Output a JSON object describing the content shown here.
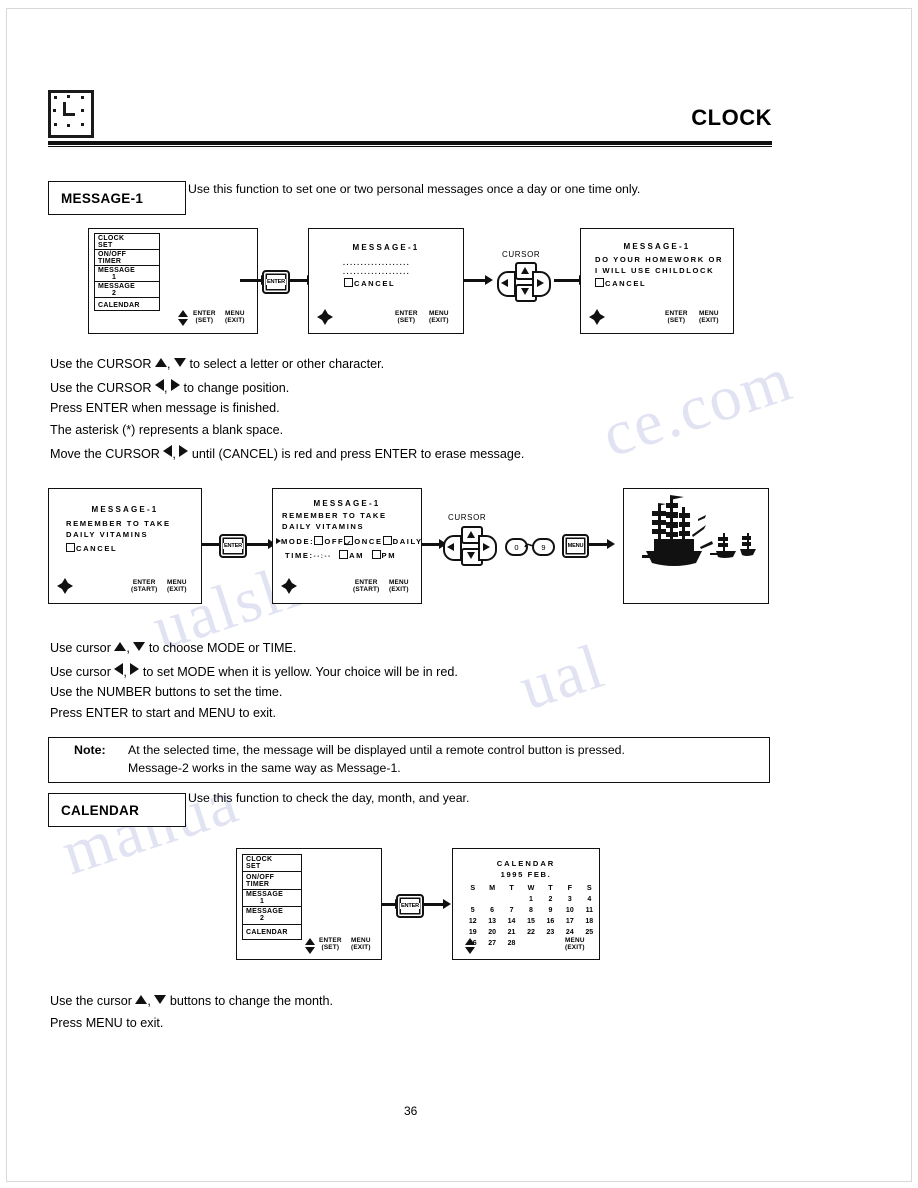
{
  "page": {
    "number": "36",
    "header_title": "CLOCK",
    "header_icon": "clock-icon"
  },
  "sections": [
    {
      "label": "MESSAGE-1",
      "intro": "Use this function to set one or two personal messages once a day or one time only."
    },
    {
      "label": "CALENDAR",
      "intro": "Use this function to check the day, month, and year."
    }
  ],
  "menu_screen": {
    "items": [
      {
        "line1": "CLOCK",
        "line2": "SET"
      },
      {
        "line1": "ON/OFF",
        "line2": "TIMER"
      },
      {
        "line1": "MESSAGE",
        "line2": "1"
      },
      {
        "line1": "MESSAGE",
        "line2": "2"
      },
      {
        "line1": "CALENDAR",
        "line2": ""
      }
    ],
    "footer_enter": "ENTER",
    "footer_enter_sub": "(SET)",
    "footer_menu": "MENU",
    "footer_menu_sub": "(EXIT)"
  },
  "osd_blank_message": {
    "title": "MESSAGE-1",
    "dots_line1": "...................",
    "dots_line2": "...................",
    "cancel": "CANCEL",
    "footer_enter": "ENTER",
    "footer_enter_sub": "(SET)",
    "footer_menu": "MENU",
    "footer_menu_sub": "(EXIT)"
  },
  "osd_childlock_message": {
    "title": "MESSAGE-1",
    "line1": "DO YOUR HOMEWORK OR",
    "line2": "I WILL USE CHILDLOCK",
    "cancel": "CANCEL",
    "footer_enter": "ENTER",
    "footer_enter_sub": "(SET)",
    "footer_menu": "MENU",
    "footer_menu_sub": "(EXIT)"
  },
  "osd_vitamins_message": {
    "title": "MESSAGE-1",
    "line1": "REMEMBER  TO  TAKE",
    "line2": "DAILY  VITAMINS",
    "cancel": "CANCEL",
    "footer_enter": "ENTER",
    "footer_enter_sub": "(START)",
    "footer_menu": "MENU",
    "footer_menu_sub": "(EXIT)"
  },
  "osd_mode_time": {
    "title": "MESSAGE-1",
    "line1": "REMEMBER  TO  TAKE",
    "line2": "DAILY  VITAMINS",
    "mode_label": "MODE:",
    "mode_options": [
      {
        "label": "OFF",
        "checked": false
      },
      {
        "label": "ONCE",
        "checked": true
      },
      {
        "label": "DAILY",
        "checked": false
      }
    ],
    "time_label": "TIME:",
    "time_value": "--:--",
    "time_options": [
      {
        "label": "AM",
        "checked": false
      },
      {
        "label": "PM",
        "checked": false
      }
    ],
    "footer_enter": "ENTER",
    "footer_enter_sub": "(START)",
    "footer_menu": "MENU",
    "footer_menu_sub": "(EXIT)"
  },
  "calendar_screen": {
    "title": "CALENDAR",
    "subtitle": "1995   FEB.",
    "weekdays": [
      "S",
      "M",
      "T",
      "W",
      "T",
      "F",
      "S"
    ],
    "weeks": [
      [
        "",
        "",
        "",
        "1",
        "2",
        "3",
        "4"
      ],
      [
        "5",
        "6",
        "7",
        "8",
        "9",
        "10",
        "11"
      ],
      [
        "12",
        "13",
        "14",
        "15",
        "16",
        "17",
        "18"
      ],
      [
        "19",
        "20",
        "21",
        "22",
        "23",
        "24",
        "25"
      ],
      [
        "26",
        "27",
        "28",
        "",
        "",
        "",
        ""
      ]
    ],
    "footer_menu": "MENU",
    "footer_menu_sub": "(EXIT)"
  },
  "buttons": {
    "enter_label": "ENTER",
    "menu_label": "MENU",
    "cursor_caption": "CURSOR",
    "number_low": "0",
    "number_high": "9"
  },
  "instructions_message": {
    "l1a": "Use the CURSOR",
    "l1b": ",",
    "l1c": "to select a letter or other character.",
    "l2a": "Use the CURSOR",
    "l2b": ",",
    "l2c": "to change position.",
    "l3": "Press ENTER when message is finished.",
    "l4": "The asterisk (*) represents a blank space.",
    "l5a": "Move the CURSOR",
    "l5b": ",",
    "l5c": "until (CANCEL) is red and press ENTER to erase message."
  },
  "instructions_mode": {
    "l1a": "Use cursor",
    "l1b": ",",
    "l1c": "to choose MODE or TIME.",
    "l2a": "Use cursor",
    "l2b": ",",
    "l2c": "to set MODE when it is yellow.  Your choice will be in red.",
    "l3": "Use the NUMBER buttons to set the time.",
    "l4": "Press ENTER to start and MENU to exit."
  },
  "note": {
    "label": "Note:",
    "line1": "At the selected time, the message will be displayed until a remote control button is pressed.",
    "line2": "Message-2 works in the same way as Message-1."
  },
  "instructions_calendar": {
    "l1a": "Use the cursor",
    "l1b": ",",
    "l1c": "buttons to change the month.",
    "l2": "Press MENU to exit."
  },
  "picture": {
    "caption_alt": "sailing-ships-illustration"
  },
  "colors": {
    "ink": "#111111",
    "paper": "#ffffff",
    "watermark": "#c9cde8"
  }
}
